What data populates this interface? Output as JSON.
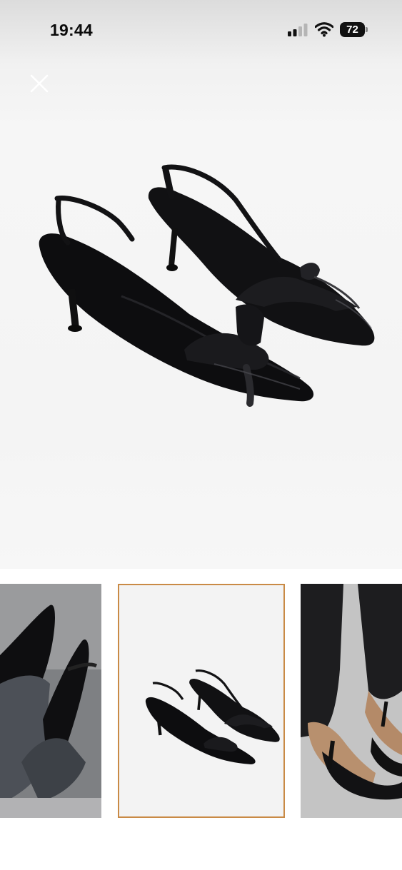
{
  "status_bar": {
    "time": "19:44",
    "battery_level": "72"
  },
  "colors": {
    "selected_border": "#c98a45",
    "shoe": "#0d0d0f",
    "background": "#f4f4f4"
  },
  "thumbnails": {
    "selected_index": 1,
    "count": 3
  }
}
